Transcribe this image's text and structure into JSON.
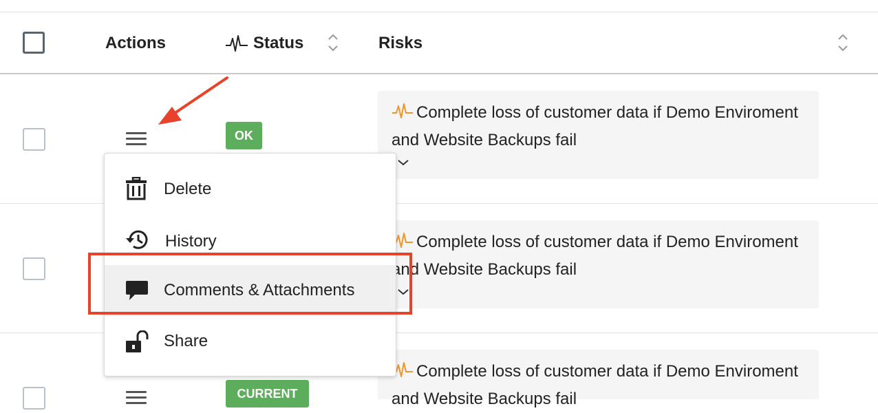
{
  "header": {
    "actions_label": "Actions",
    "status_label": "Status",
    "risks_label": "Risks"
  },
  "rows": [
    {
      "status": "OK",
      "risk": "Complete loss of customer data if Demo Enviroment and Website Backups fail"
    },
    {
      "status": "",
      "risk": "Complete loss of customer data if Demo Enviroment and Website Backups fail"
    },
    {
      "status": "CURRENT",
      "risk": "Complete loss of customer data if Demo Enviroment and Website Backups fail"
    }
  ],
  "menu": {
    "items": [
      {
        "label": "Delete",
        "icon": "trash-icon"
      },
      {
        "label": "History",
        "icon": "history-icon"
      },
      {
        "label": "Comments & Attachments",
        "icon": "comment-icon"
      },
      {
        "label": "Share",
        "icon": "unlock-icon"
      }
    ]
  },
  "colors": {
    "ok_badge": "#5cad5c",
    "risk_icon": "#f0952a",
    "annotation": "#e8432a"
  }
}
